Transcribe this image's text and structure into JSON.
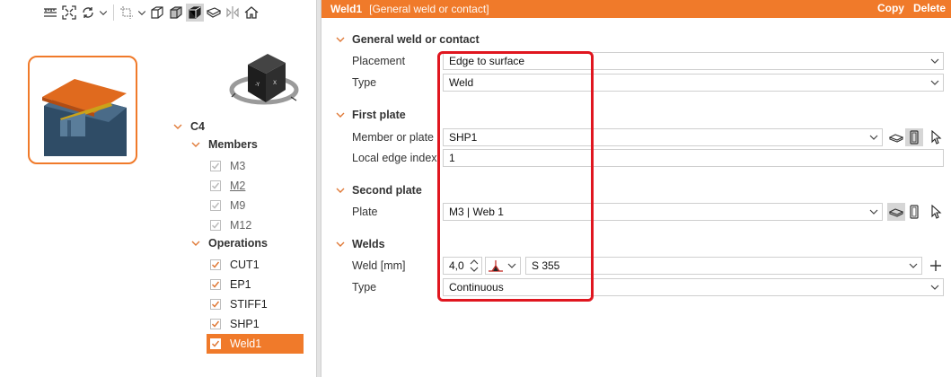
{
  "toolbar": {
    "icons": [
      "ruler-icon",
      "fit-view-icon",
      "rotate-icon",
      "chevron-down-icon",
      "crop-icon",
      "chevron-down-icon",
      "wireframe-cube-icon",
      "shaded-cube-icon",
      "solid-cube-icon",
      "plate-view-icon",
      "symmetry-icon",
      "home-icon"
    ]
  },
  "tree": {
    "root": "C4",
    "members_label": "Members",
    "members": [
      "M3",
      "M2",
      "M9",
      "M12"
    ],
    "operations_label": "Operations",
    "operations": [
      "CUT1",
      "EP1",
      "STIFF1",
      "SHP1",
      "Weld1"
    ]
  },
  "header": {
    "title": "Weld1",
    "subtitle": "[General weld or contact]",
    "copy": "Copy",
    "delete": "Delete"
  },
  "sections": {
    "general": {
      "title": "General weld or contact",
      "placement_label": "Placement",
      "placement_value": "Edge to surface",
      "type_label": "Type",
      "type_value": "Weld"
    },
    "first_plate": {
      "title": "First plate",
      "member_label": "Member or plate",
      "member_value": "SHP1",
      "edge_label": "Local edge index",
      "edge_value": "1"
    },
    "second_plate": {
      "title": "Second plate",
      "plate_label": "Plate",
      "plate_value": "M3 | Web 1"
    },
    "welds": {
      "title": "Welds",
      "weld_label": "Weld [mm]",
      "weld_value": "4,0",
      "material_value": "S 355",
      "type_label": "Type",
      "type_value": "Continuous"
    }
  },
  "colors": {
    "accent": "#f07a2a",
    "highlight": "#e0161f"
  }
}
